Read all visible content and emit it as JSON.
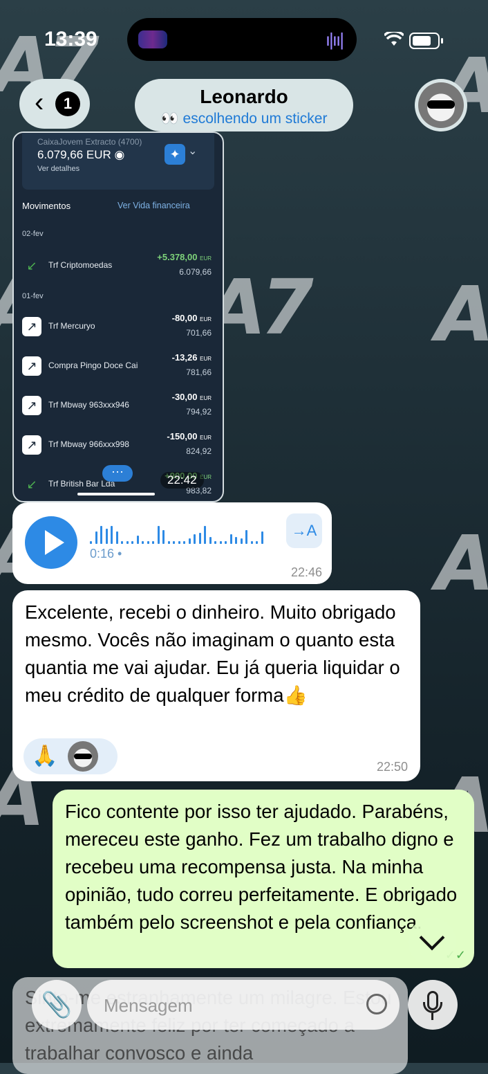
{
  "status": {
    "time": "13:39"
  },
  "header": {
    "back_count": "1",
    "contact_name": "Leonardo",
    "contact_status": "👀 escolhendo um sticker"
  },
  "bank": {
    "account_name": "CaixaJovem Extracto (4700)",
    "balance": "6.079,66 EUR",
    "details_link": "Ver detalhes",
    "movements_title": "Movimentos",
    "vida_link": "Ver Vida financeira",
    "dates": [
      "02-fev",
      "01-fev"
    ],
    "transactions": [
      {
        "label": "Trf Criptomoedas",
        "amount": "+5.378,00",
        "currency": "EUR",
        "balance": "6.079,66",
        "direction": "in"
      },
      {
        "label": "Trf Mercuryo",
        "amount": "-80,00",
        "currency": "EUR",
        "balance": "701,66",
        "direction": "out"
      },
      {
        "label": "Compra Pingo Doce Cai",
        "amount": "-13,26",
        "currency": "EUR",
        "balance": "781,66",
        "direction": "out"
      },
      {
        "label": "Trf Mbway 963xxx946",
        "amount": "-30,00",
        "currency": "EUR",
        "balance": "794,92",
        "direction": "out"
      },
      {
        "label": "Trf Mbway 966xxx998",
        "amount": "-150,00",
        "currency": "EUR",
        "balance": "824,92",
        "direction": "out"
      },
      {
        "label": "Trf British Bar Lda",
        "amount": "+900,00",
        "currency": "EUR",
        "balance": "983,82",
        "direction": "in"
      }
    ],
    "more_label": "···",
    "timestamp": "22:42"
  },
  "voice": {
    "duration": "0:16",
    "transcribe_label": "→A",
    "time": "22:46"
  },
  "incoming": {
    "text": "Excelente, recebi o dinheiro. Muito obrigado mesmo. Vocês não imaginam o quanto esta quantia me vai ajudar. Eu já queria liquidar o meu crédito de qualquer forma👍",
    "reaction": "🙏",
    "time": "22:50"
  },
  "outgoing": {
    "text": "Fico contente por isso ter ajudado. Parabéns, mereceu este ganho. Fez um trabalho digno e recebeu uma recompensa justa. Na minha opinião, tudo correu perfeitamente. E obrigado também pelo screenshot e pela confiança.",
    "checks": "✓✓"
  },
  "ghost_message": {
    "text": "Sinto-me estranhamente um milagre. Estou extremamente feliz por ter começado a trabalhar convosco e ainda"
  },
  "composer": {
    "placeholder": "Mensagem",
    "attach_icon": "📎"
  },
  "colors": {
    "accent": "#2d8ae5",
    "outgoing_bubble": "#e1fec6",
    "incoming_bubble": "#ffffff"
  }
}
